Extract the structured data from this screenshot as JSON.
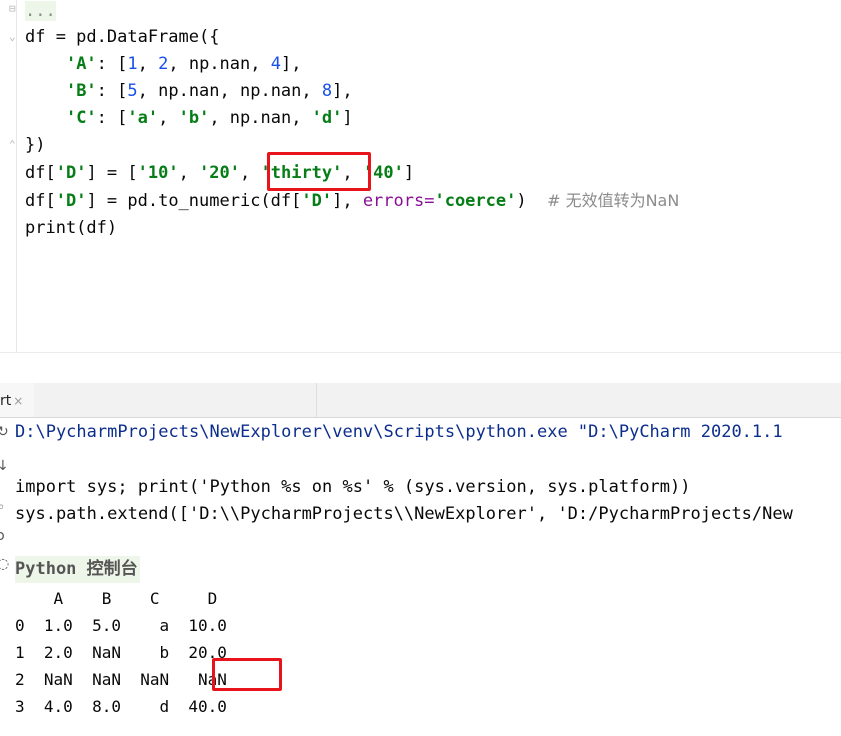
{
  "editor": {
    "ellipsis": "...",
    "code": {
      "l1": "df = pd.DataFrame({",
      "l2_key": "'A'",
      "l2_a": ": [",
      "l2_n1": "1",
      "l2_s1": ", ",
      "l2_n2": "2",
      "l2_s2": ", np.nan, ",
      "l2_n3": "4",
      "l2_end": "],",
      "l3_key": "'B'",
      "l3_a": ": [",
      "l3_n1": "5",
      "l3_s1": ", np.nan, np.nan, ",
      "l3_n2": "8",
      "l3_end": "],",
      "l4_key": "'C'",
      "l4_a": ": [",
      "l4_s1": "'a'",
      "l4_c1": ", ",
      "l4_s2": "'b'",
      "l4_c2": ", np.nan, ",
      "l4_s3": "'d'",
      "l4_end": "]",
      "l5": "})",
      "l6_a": "df[",
      "l6_key": "'D'",
      "l6_b": "] = [",
      "l6_s1": "'10'",
      "l6_c1": ", ",
      "l6_s2": "'20'",
      "l6_c2": ", ",
      "l6_s3": "'thirty'",
      "l6_c3": ", ",
      "l6_s4": "'40'",
      "l6_end": "]",
      "l7_a": "df[",
      "l7_key": "'D'",
      "l7_b": "] = pd.to_numeric(df[",
      "l7_key2": "'D'",
      "l7_c": "], ",
      "l7_kw": "errors=",
      "l7_s": "'coerce'",
      "l7_d": ")  ",
      "l7_cmt": "# 无效值转为NaN",
      "l8": "print(df)"
    }
  },
  "run_tab": {
    "label": "rt",
    "close": "×"
  },
  "console": {
    "cmd": "D:\\PycharmProjects\\NewExplorer\\venv\\Scripts\\python.exe \"D:\\PyCharm 2020.1.1",
    "import_line": "import sys; print('Python %s on %s' % (sys.version, sys.platform))",
    "path_line": "sys.path.extend(['D:\\\\PycharmProjects\\\\NewExplorer', 'D:/PycharmProjects/New",
    "banner": "Python 控制台",
    "table": {
      "header": "    A    B    C     D",
      "rows": [
        "0  1.0  5.0    a  10.0",
        "1  2.0  NaN    b  20.0",
        "2  NaN  NaN  NaN   NaN",
        "3  4.0  8.0    d  40.0"
      ]
    }
  }
}
